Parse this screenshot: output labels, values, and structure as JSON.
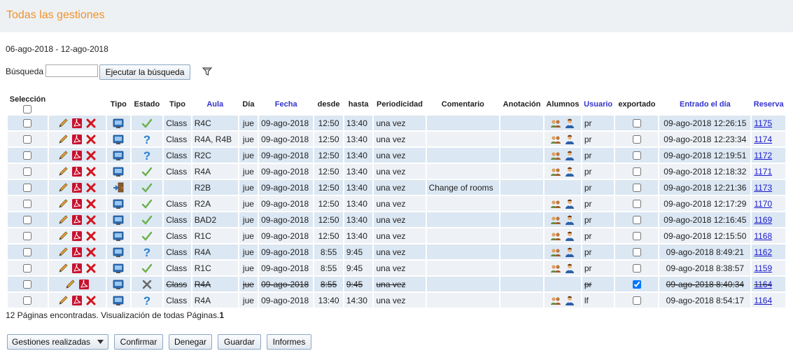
{
  "header": {
    "title": "Todas las gestiones"
  },
  "date_range": "06-ago-2018 - 12-ago-2018",
  "search": {
    "label": "Búsqueda",
    "value": "",
    "placeholder": "",
    "button_label": "Ejecutar la búsqueda",
    "filter_icon": "funnel-icon"
  },
  "table": {
    "columns": [
      "Selección",
      "",
      "Tipo",
      "Estado",
      "Tipo",
      "Aula",
      "Día",
      "Fecha",
      "desde",
      "hasta",
      "Periodicidad",
      "Comentario",
      "Anotación",
      "Alumnos",
      "Usuario",
      "exportado",
      "Entrado el día",
      "Reserva"
    ],
    "link_columns": [
      "Aula",
      "Fecha",
      "Usuario",
      "Entrado el día",
      "Reserva"
    ],
    "rows": [
      {
        "actions": [
          "pencil",
          "pdf",
          "delete"
        ],
        "tipo_icon": "screen-icon",
        "estado": "check",
        "tipo": "Class",
        "aula": "R4C",
        "dia": "jue",
        "fecha": "09-ago-2018",
        "desde": "12:50",
        "hasta": "13:40",
        "periodicidad": "una vez",
        "comentario": "",
        "anotacion": "",
        "alumnos": true,
        "usuario": "pr",
        "exportado": false,
        "entrado": "09-ago-2018 12:26:15",
        "reserva": "1175",
        "struck": false
      },
      {
        "actions": [
          "pencil",
          "pdf",
          "delete"
        ],
        "tipo_icon": "screen-icon",
        "estado": "question",
        "tipo": "Class",
        "aula": "R4A, R4B",
        "dia": "jue",
        "fecha": "09-ago-2018",
        "desde": "12:50",
        "hasta": "13:40",
        "periodicidad": "una vez",
        "comentario": "",
        "anotacion": "",
        "alumnos": true,
        "usuario": "pr",
        "exportado": false,
        "entrado": "09-ago-2018 12:23:34",
        "reserva": "1174",
        "struck": false
      },
      {
        "actions": [
          "pencil",
          "pdf",
          "delete"
        ],
        "tipo_icon": "screen-icon",
        "estado": "question",
        "tipo": "Class",
        "aula": "R2C",
        "dia": "jue",
        "fecha": "09-ago-2018",
        "desde": "12:50",
        "hasta": "13:40",
        "periodicidad": "una vez",
        "comentario": "",
        "anotacion": "",
        "alumnos": true,
        "usuario": "pr",
        "exportado": false,
        "entrado": "09-ago-2018 12:19:51",
        "reserva": "1172",
        "struck": false
      },
      {
        "actions": [
          "pencil",
          "pdf",
          "delete"
        ],
        "tipo_icon": "screen-icon",
        "estado": "check",
        "tipo": "Class",
        "aula": "R4A",
        "dia": "jue",
        "fecha": "09-ago-2018",
        "desde": "12:50",
        "hasta": "13:40",
        "periodicidad": "una vez",
        "comentario": "",
        "anotacion": "",
        "alumnos": true,
        "usuario": "pr",
        "exportado": false,
        "entrado": "09-ago-2018 12:18:32",
        "reserva": "1171",
        "struck": false
      },
      {
        "actions": [
          "pencil",
          "pdf",
          "delete"
        ],
        "tipo_icon": "room-change-icon",
        "estado": "check",
        "tipo": "",
        "aula": "R2B",
        "dia": "jue",
        "fecha": "09-ago-2018",
        "desde": "12:50",
        "hasta": "13:40",
        "periodicidad": "una vez",
        "comentario": "Change of rooms",
        "anotacion": "",
        "alumnos": false,
        "usuario": "pr",
        "exportado": false,
        "entrado": "09-ago-2018 12:21:36",
        "reserva": "1173",
        "struck": false
      },
      {
        "actions": [
          "pencil",
          "pdf",
          "delete"
        ],
        "tipo_icon": "screen-icon",
        "estado": "check",
        "tipo": "Class",
        "aula": "R2A",
        "dia": "jue",
        "fecha": "09-ago-2018",
        "desde": "12:50",
        "hasta": "13:40",
        "periodicidad": "una vez",
        "comentario": "",
        "anotacion": "",
        "alumnos": true,
        "usuario": "pr",
        "exportado": false,
        "entrado": "09-ago-2018 12:17:29",
        "reserva": "1170",
        "struck": false
      },
      {
        "actions": [
          "pencil",
          "pdf",
          "delete"
        ],
        "tipo_icon": "screen-icon",
        "estado": "check",
        "tipo": "Class",
        "aula": "BAD2",
        "dia": "jue",
        "fecha": "09-ago-2018",
        "desde": "12:50",
        "hasta": "13:40",
        "periodicidad": "una vez",
        "comentario": "",
        "anotacion": "",
        "alumnos": true,
        "usuario": "pr",
        "exportado": false,
        "entrado": "09-ago-2018 12:16:45",
        "reserva": "1169",
        "struck": false
      },
      {
        "actions": [
          "pencil",
          "pdf",
          "delete"
        ],
        "tipo_icon": "screen-icon",
        "estado": "check",
        "tipo": "Class",
        "aula": "R1C",
        "dia": "jue",
        "fecha": "09-ago-2018",
        "desde": "12:50",
        "hasta": "13:40",
        "periodicidad": "una vez",
        "comentario": "",
        "anotacion": "",
        "alumnos": true,
        "usuario": "pr",
        "exportado": false,
        "entrado": "09-ago-2018 12:15:50",
        "reserva": "1168",
        "struck": false
      },
      {
        "actions": [
          "pencil",
          "pdf",
          "delete"
        ],
        "tipo_icon": "screen-icon",
        "estado": "question",
        "tipo": "Class",
        "aula": "R4A",
        "dia": "jue",
        "fecha": "09-ago-2018",
        "desde": "8:55",
        "hasta": "9:45",
        "periodicidad": "una vez",
        "comentario": "",
        "anotacion": "",
        "alumnos": true,
        "usuario": "pr",
        "exportado": false,
        "entrado": "09-ago-2018 8:49:21",
        "reserva": "1162",
        "struck": false
      },
      {
        "actions": [
          "pencil",
          "pdf",
          "delete"
        ],
        "tipo_icon": "screen-icon",
        "estado": "check",
        "tipo": "Class",
        "aula": "R1C",
        "dia": "jue",
        "fecha": "09-ago-2018",
        "desde": "8:55",
        "hasta": "9:45",
        "periodicidad": "una vez",
        "comentario": "",
        "anotacion": "",
        "alumnos": true,
        "usuario": "pr",
        "exportado": false,
        "entrado": "09-ago-2018 8:38:57",
        "reserva": "1159",
        "struck": false
      },
      {
        "actions": [
          "pencil",
          "pdf"
        ],
        "tipo_icon": "screen-icon",
        "estado": "cross",
        "tipo": "Class",
        "aula": "R4A",
        "dia": "jue",
        "fecha": "09-ago-2018",
        "desde": "8:55",
        "hasta": "9:45",
        "periodicidad": "una vez",
        "comentario": "",
        "anotacion": "",
        "alumnos": false,
        "usuario": "pr",
        "exportado": true,
        "entrado": "09-ago-2018 8:40:34",
        "reserva": "1164",
        "struck": true
      },
      {
        "actions": [
          "pencil",
          "pdf",
          "delete"
        ],
        "tipo_icon": "screen-icon",
        "estado": "question",
        "tipo": "Class",
        "aula": "R4A",
        "dia": "jue",
        "fecha": "09-ago-2018",
        "desde": "13:40",
        "hasta": "14:30",
        "periodicidad": "una vez",
        "comentario": "",
        "anotacion": "",
        "alumnos": true,
        "usuario": "lf",
        "exportado": false,
        "entrado": "09-ago-2018 8:54:17",
        "reserva": "1164",
        "struck": false
      }
    ]
  },
  "footer": {
    "pages_text": "12 Páginas encontradas. Visualización de todas Páginas.",
    "pages_count": "1"
  },
  "buttons": {
    "gestiones": "Gestiones realizadas",
    "confirmar": "Confirmar",
    "denegar": "Denegar",
    "guardar": "Guardar",
    "informes": "Informes"
  },
  "colors": {
    "title": "#f0922b",
    "row_odd": "#dbe7f3",
    "row_even": "#eef2f6",
    "link": "#3333cc"
  }
}
